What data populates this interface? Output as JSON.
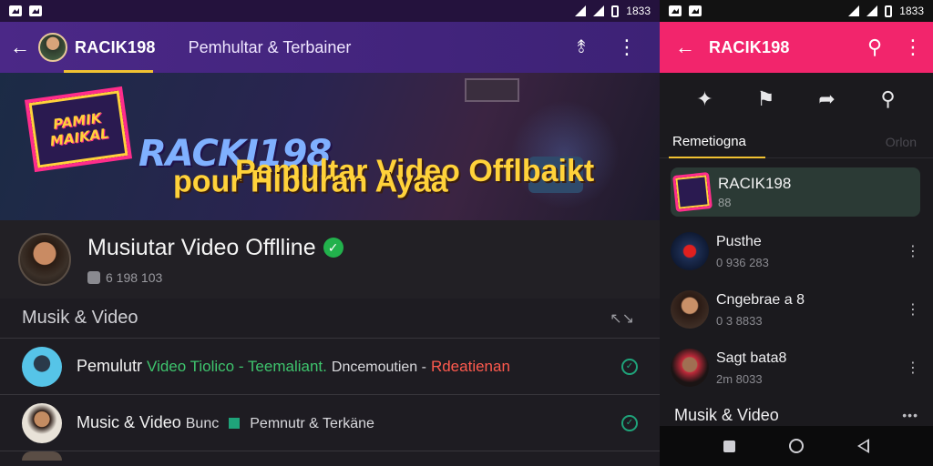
{
  "left": {
    "status": {
      "time": "1833"
    },
    "appbar": {
      "title": "RACIK198",
      "subtitle": "Pemhultar & Terbainer"
    },
    "banner": {
      "badge_line1": "PAMIK",
      "badge_line2": "MAIKAL",
      "brand": "RACKI198",
      "line1": "Pemultar Video Offlbaikt",
      "line2": "pour Hiburan Ayaa"
    },
    "channel": {
      "name": "Musiutar Video Offlline",
      "meta": "6 198 103"
    },
    "section": {
      "title": "Musik & Video"
    },
    "rows": [
      {
        "title": "Pemulutr",
        "green": "Video Tiolico - Teemaliant.",
        "dim": "Dncemoutien -",
        "red": "Rdeatienan"
      },
      {
        "title": "Music & Video",
        "dim1": "Bunc",
        "dim2": "Pemnutr & Terkäne"
      }
    ]
  },
  "right": {
    "status": {
      "time": "1833"
    },
    "appbar": {
      "title": "RACIK198"
    },
    "tabs": {
      "active": "Remetiogna",
      "other": "Orlon"
    },
    "featured": {
      "title": "RACIK198",
      "sub": "88"
    },
    "items": [
      {
        "title": "Pusthe",
        "sub": "0 936 283"
      },
      {
        "title": "Cngebrae a 8",
        "sub": "0 3 8833"
      },
      {
        "title": "Sagt bata8",
        "sub": "2m 8033"
      }
    ],
    "section": {
      "title": "Musik & Video"
    }
  },
  "colors": {
    "left_appbar": "#4b2887",
    "right_appbar": "#f2256c",
    "accent_underline": "#f1c232",
    "verified": "#22b14c",
    "teal": "#1fa37a"
  }
}
